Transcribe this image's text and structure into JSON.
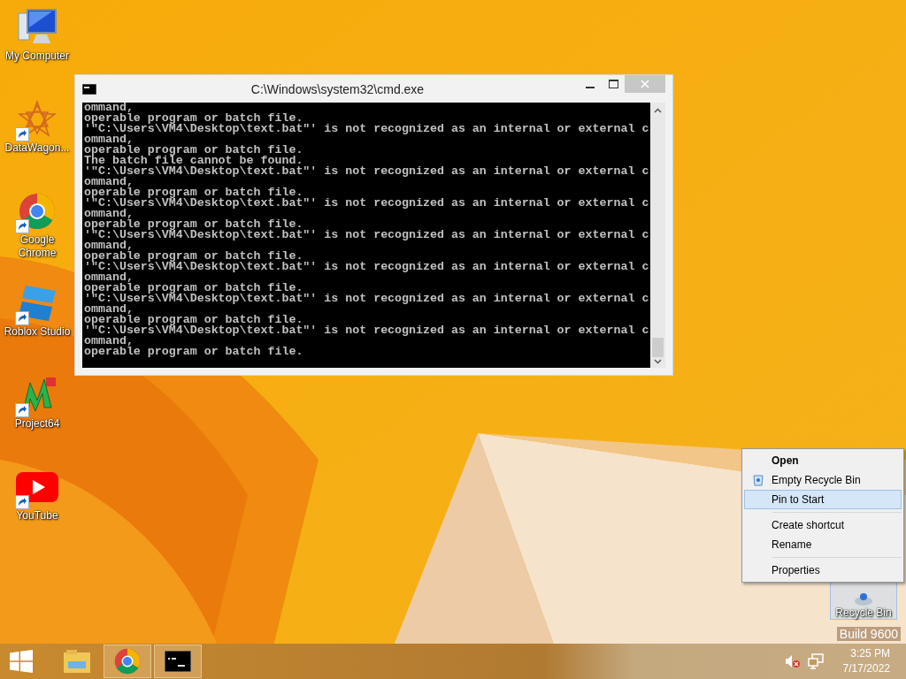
{
  "desktop_icons": [
    {
      "label": "My Computer",
      "kind": "computer",
      "shortcut": false
    },
    {
      "label": "DataWagon...",
      "kind": "star",
      "shortcut": true
    },
    {
      "label": "Google Chrome",
      "kind": "chrome",
      "shortcut": true
    },
    {
      "label": "Roblox Studio",
      "kind": "roblox",
      "shortcut": true
    },
    {
      "label": "Project64",
      "kind": "project64",
      "shortcut": true
    },
    {
      "label": "YouTube",
      "kind": "youtube",
      "shortcut": true
    }
  ],
  "window": {
    "title": "C:\\Windows\\system32\\cmd.exe",
    "console_lines": [
      "ommand,",
      "operable program or batch file.",
      "'\"C:\\Users\\VM4\\Desktop\\text.bat\"' is not recognized as an internal or external c",
      "ommand,",
      "operable program or batch file.",
      "The batch file cannot be found.",
      "'\"C:\\Users\\VM4\\Desktop\\text.bat\"' is not recognized as an internal or external c",
      "ommand,",
      "operable program or batch file.",
      "'\"C:\\Users\\VM4\\Desktop\\text.bat\"' is not recognized as an internal or external c",
      "ommand,",
      "operable program or batch file.",
      "'\"C:\\Users\\VM4\\Desktop\\text.bat\"' is not recognized as an internal or external c",
      "ommand,",
      "operable program or batch file.",
      "'\"C:\\Users\\VM4\\Desktop\\text.bat\"' is not recognized as an internal or external c",
      "ommand,",
      "operable program or batch file.",
      "'\"C:\\Users\\VM4\\Desktop\\text.bat\"' is not recognized as an internal or external c",
      "ommand,",
      "operable program or batch file.",
      "'\"C:\\Users\\VM4\\Desktop\\text.bat\"' is not recognized as an internal or external c",
      "ommand,",
      "operable program or batch file."
    ]
  },
  "context_menu": [
    {
      "kind": "item",
      "label": "Open",
      "default": true,
      "selected": false,
      "icon": false
    },
    {
      "kind": "item",
      "label": "Empty Recycle Bin",
      "default": false,
      "selected": false,
      "icon": true
    },
    {
      "kind": "item",
      "label": "Pin to Start",
      "default": false,
      "selected": true,
      "icon": false
    },
    {
      "kind": "separator"
    },
    {
      "kind": "item",
      "label": "Create shortcut",
      "default": false,
      "selected": false,
      "icon": false
    },
    {
      "kind": "item",
      "label": "Rename",
      "default": false,
      "selected": false,
      "icon": false
    },
    {
      "kind": "separator"
    },
    {
      "kind": "item",
      "label": "Properties",
      "default": false,
      "selected": false,
      "icon": false
    }
  ],
  "recycle_bin": {
    "label": "Recycle Bin",
    "selected": true
  },
  "watermark": {
    "build": "Build 9600"
  },
  "taskbar": {
    "apps": [
      {
        "kind": "explorer",
        "active": false
      },
      {
        "kind": "chrome",
        "active": true
      },
      {
        "kind": "cmd",
        "active": true
      }
    ],
    "clock": {
      "time": "3:25 PM",
      "date": "7/17/2022"
    }
  }
}
